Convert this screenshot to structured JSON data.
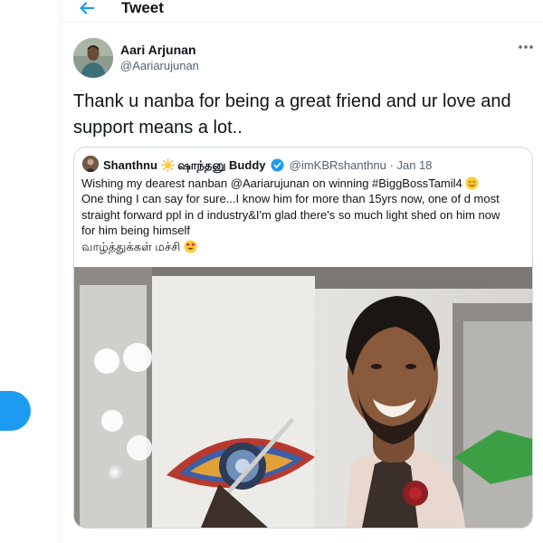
{
  "header": {
    "title": "Tweet"
  },
  "tweet": {
    "author_name": "Aari Arjunan",
    "author_handle": "@Aariarujunan",
    "text_lines": [
      "Thank u nanba for being a great friend and ur love and",
      "support means a lot.."
    ]
  },
  "quote": {
    "name": "Shanthnu",
    "name_tamil": "ஷாந்தனு",
    "name_suffix": "Buddy",
    "handle": "@imKBRshanthnu",
    "separator": "·",
    "date": "Jan 18",
    "lines": [
      "Wishing my dearest nanban @Aariarujunan on winning #BiggBossTamil4",
      "One thing I can say for sure...I know him for more than 15yrs now, one of d most",
      "straight forward ppl  in d industry&I'm glad there's so much light shed on him now",
      "for him being himself",
      "வாழ்த்துக்கள் மச்சி"
    ]
  },
  "colors": {
    "accent": "#1d9bf0",
    "text": "#0f1419",
    "muted": "#536471",
    "border": "#cfd9de"
  },
  "icons": {
    "back": "arrow-left-icon",
    "more": "more-dots-icon",
    "verified": "verified-badge-icon",
    "sun": "sun-emoji-icon",
    "smile": "smiling-face-emoji-icon",
    "heart_eyes": "heart-eyes-emoji-icon"
  }
}
